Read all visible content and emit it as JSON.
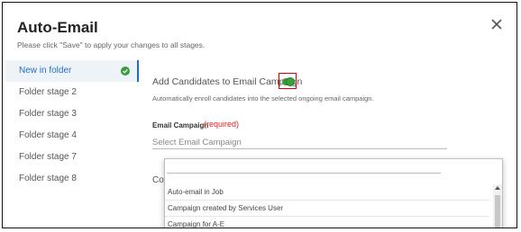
{
  "dialog": {
    "title": "Auto-Email",
    "subtitle": "Please click \"Save\" to apply your changes to all stages."
  },
  "sidebar": {
    "items": [
      {
        "label": "New in folder",
        "active": true,
        "checked": true
      },
      {
        "label": "Folder stage 2"
      },
      {
        "label": "Folder stage 3"
      },
      {
        "label": "Folder stage 4"
      },
      {
        "label": "Folder stage 7"
      },
      {
        "label": "Folder stage 8"
      }
    ]
  },
  "main": {
    "toggle_label": "Add Candidates to Email Campaign",
    "toggle_on": true,
    "help_text": "Automatically enroll candidates into the selected ongoing email campaign.",
    "field_label": "Email Campaign",
    "required_text": "(required)",
    "select_placeholder": "Select Email Campaign",
    "partial_label": "Co"
  },
  "dropdown": {
    "options": [
      "Auto-email in Job",
      "Campaign created by Services User",
      "Campaign for A-E"
    ]
  },
  "colors": {
    "accent": "#1f6fc0",
    "toggle_on": "#3a9c3a",
    "required": "#e02020",
    "highlight_box": "#dd0000"
  }
}
